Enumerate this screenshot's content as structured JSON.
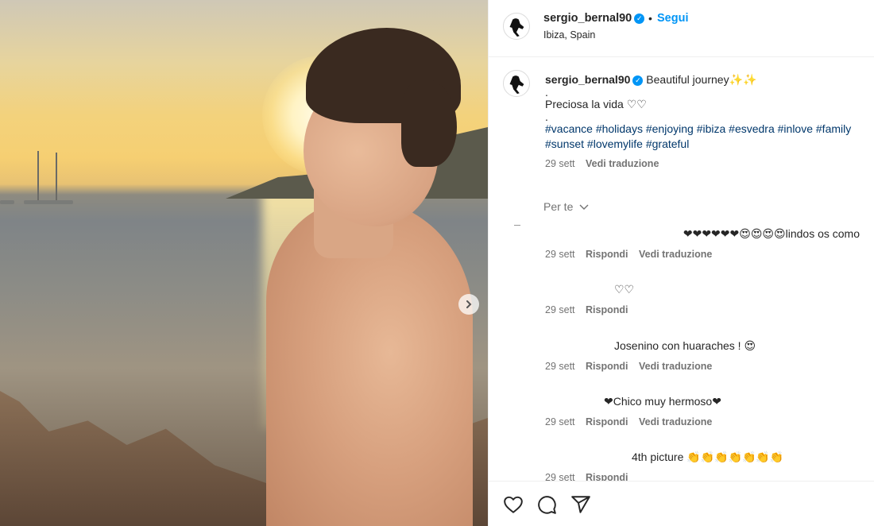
{
  "header": {
    "username": "sergio_bernal90",
    "dot": "•",
    "follow_label": "Segui",
    "location": "Ibiza, Spain"
  },
  "caption": {
    "username": "sergio_bernal90",
    "line1": "Beautiful journey✨✨",
    "dot1": ".",
    "line2": "Preciosa la vida ♡♡",
    "dot2": ".",
    "hashtags_line1": "#vacance #holidays #enjoying #ibiza #esvedra #inlove #family",
    "hashtags_line2": "#sunset #lovemylife #grateful",
    "time": "29 sett",
    "translate": "Vedi traduzione"
  },
  "filter_label": "Per te",
  "comments": [
    {
      "text": "❤❤❤❤❤❤😍😍😍😍lindos os como",
      "time": "29 sett",
      "reply": "Rispondi",
      "translate": "Vedi traduzione"
    },
    {
      "text": "♡♡",
      "time": "29 sett",
      "reply": "Rispondi"
    },
    {
      "text": "Josenino con huaraches ! 😍",
      "time": "29 sett",
      "reply": "Rispondi",
      "translate": "Vedi traduzione"
    },
    {
      "text": "❤Chico muy hermoso❤",
      "time": "29 sett",
      "reply": "Rispondi",
      "translate": "Vedi traduzione"
    },
    {
      "text": "4th picture 👏👏👏👏👏👏👏",
      "time": "29 sett",
      "reply": "Rispondi"
    }
  ],
  "icons": {
    "carousel_next": "chevron-right-icon",
    "like": "heart-icon",
    "comment": "comment-icon",
    "share": "share-icon",
    "verified": "verified-badge-icon",
    "filter": "chevron-down-icon"
  },
  "colors": {
    "link_blue": "#0095f6",
    "hashtag": "#00376b",
    "secondary_text": "#737373"
  }
}
